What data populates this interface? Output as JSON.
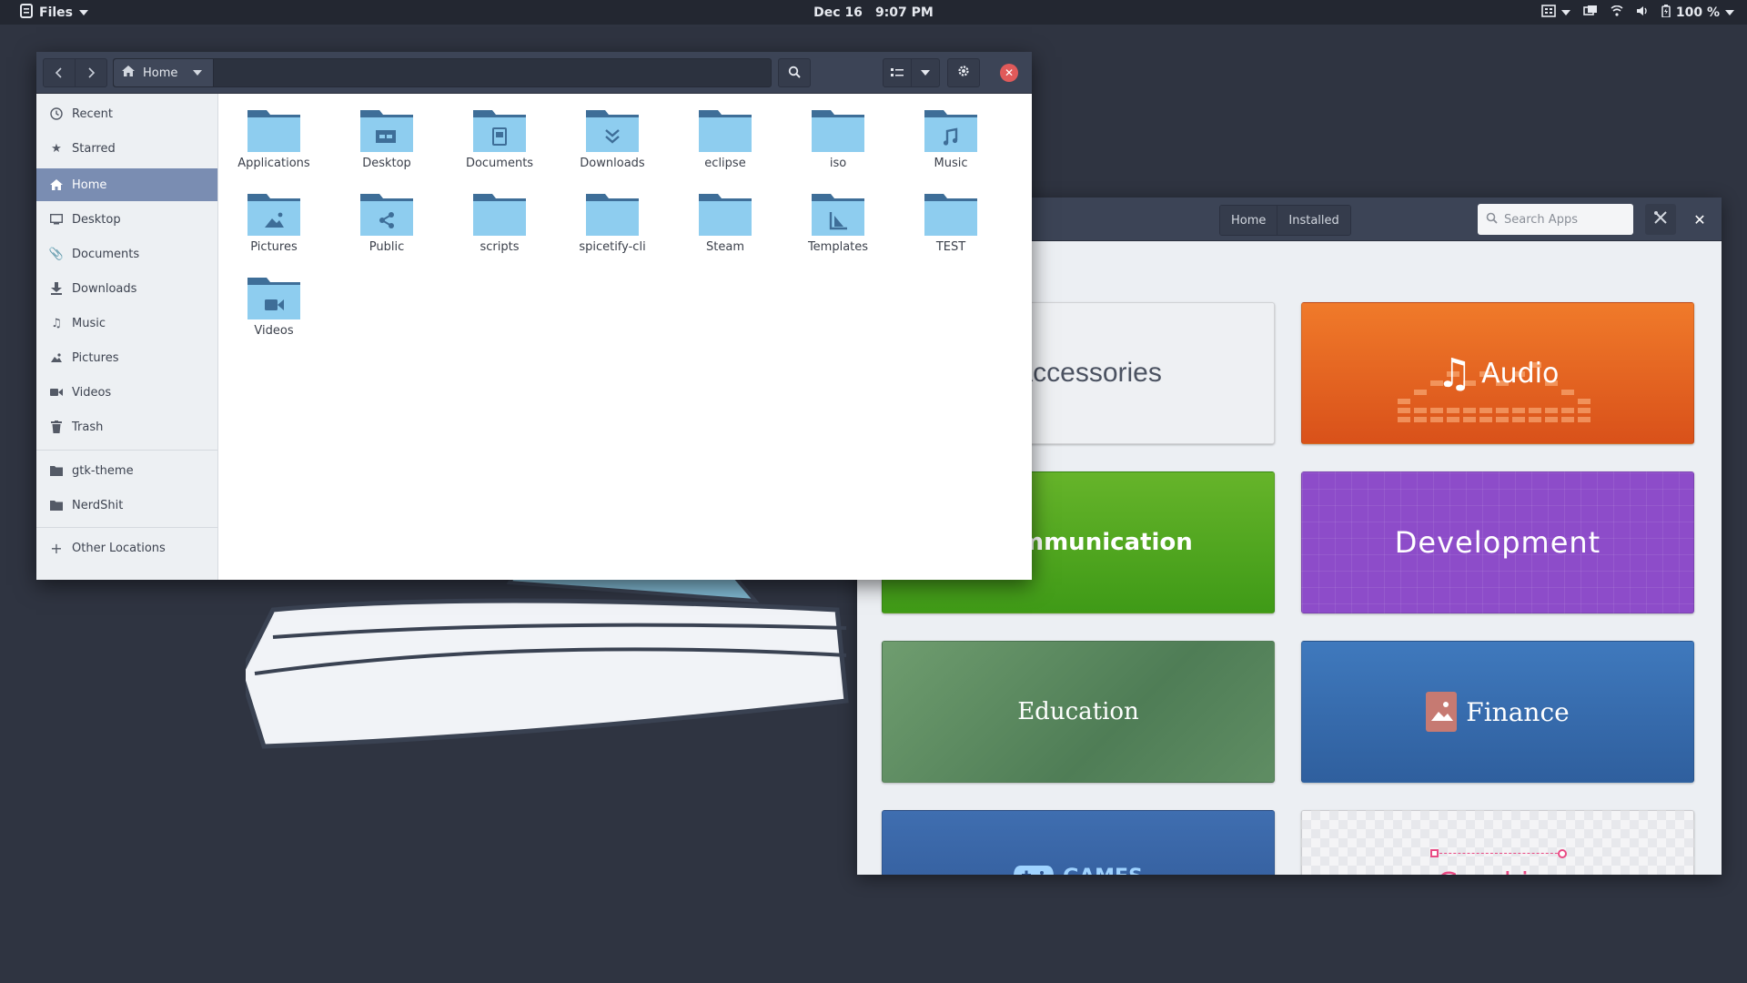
{
  "topbar": {
    "app_name": "Files",
    "date": "Dec 16",
    "time": "9:07 PM",
    "volume_percent": "100 %",
    "icons": [
      "grid-menu-icon",
      "screen-icon",
      "wifi-icon",
      "volume-icon",
      "battery-icon"
    ]
  },
  "files": {
    "path_label": "Home",
    "sidebar": [
      {
        "label": "Recent",
        "icon": "clock-icon"
      },
      {
        "label": "Starred",
        "icon": "star-icon"
      },
      {
        "label": "Home",
        "icon": "home-icon",
        "active": true
      },
      {
        "label": "Desktop",
        "icon": "desktop-icon"
      },
      {
        "label": "Documents",
        "icon": "paperclip-icon"
      },
      {
        "label": "Downloads",
        "icon": "download-icon"
      },
      {
        "label": "Music",
        "icon": "music-icon"
      },
      {
        "label": "Pictures",
        "icon": "camera-icon"
      },
      {
        "label": "Videos",
        "icon": "video-icon"
      },
      {
        "label": "Trash",
        "icon": "trash-icon"
      }
    ],
    "bookmarks": [
      {
        "label": "gtk-theme",
        "icon": "folder-icon"
      },
      {
        "label": "NerdShit",
        "icon": "folder-icon"
      }
    ],
    "other_locations": "Other Locations",
    "folders": [
      {
        "label": "Applications",
        "emblem": "none"
      },
      {
        "label": "Desktop",
        "emblem": "desktop"
      },
      {
        "label": "Documents",
        "emblem": "document"
      },
      {
        "label": "Downloads",
        "emblem": "download"
      },
      {
        "label": "eclipse",
        "emblem": "none"
      },
      {
        "label": "iso",
        "emblem": "none"
      },
      {
        "label": "Music",
        "emblem": "music"
      },
      {
        "label": "Pictures",
        "emblem": "picture"
      },
      {
        "label": "Public",
        "emblem": "share"
      },
      {
        "label": "scripts",
        "emblem": "none"
      },
      {
        "label": "spicetify-cli",
        "emblem": "none"
      },
      {
        "label": "Steam",
        "emblem": "none"
      },
      {
        "label": "Templates",
        "emblem": "template"
      },
      {
        "label": "TEST",
        "emblem": "none"
      },
      {
        "label": "Videos",
        "emblem": "video"
      }
    ]
  },
  "store": {
    "tabs": [
      "Home",
      "Installed"
    ],
    "search_placeholder": "Search Apps",
    "categories": [
      {
        "label": "Accessories"
      },
      {
        "label": "Audio"
      },
      {
        "label": "mmunication"
      },
      {
        "label": "Development"
      },
      {
        "label": "Education"
      },
      {
        "label": "Finance"
      },
      {
        "label": "GAMES"
      },
      {
        "label": "Graphics"
      }
    ]
  },
  "colors": {
    "desktop_bg": "#2f3441",
    "header_bg": "#3c4456",
    "sidebar_active": "#7a8db2",
    "folder_light": "#8ecdef",
    "folder_dark": "#3e6e98"
  }
}
